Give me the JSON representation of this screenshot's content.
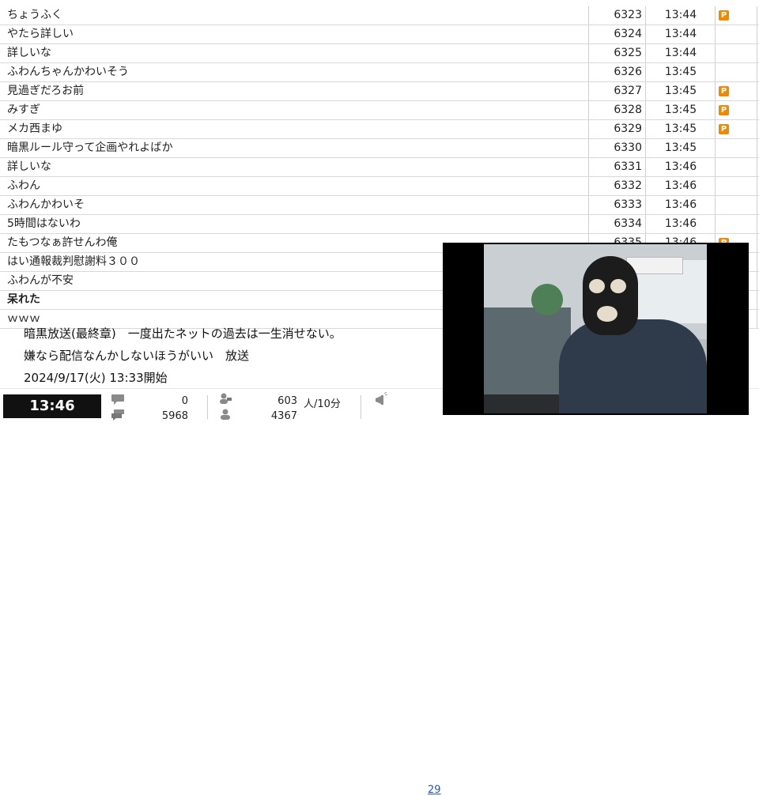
{
  "comments": [
    {
      "text": "ちょうふく",
      "num": "6323",
      "time": "13:44",
      "premium": true,
      "bold": false
    },
    {
      "text": "やたら詳しい",
      "num": "6324",
      "time": "13:44",
      "premium": false,
      "bold": false
    },
    {
      "text": "詳しいな",
      "num": "6325",
      "time": "13:44",
      "premium": false,
      "bold": false
    },
    {
      "text": "ふわんちゃんかわいそう",
      "num": "6326",
      "time": "13:45",
      "premium": false,
      "bold": false
    },
    {
      "text": "見過ぎだろお前",
      "num": "6327",
      "time": "13:45",
      "premium": true,
      "bold": false
    },
    {
      "text": "みすぎ",
      "num": "6328",
      "time": "13:45",
      "premium": true,
      "bold": false
    },
    {
      "text": "メカ西まゆ",
      "num": "6329",
      "time": "13:45",
      "premium": true,
      "bold": false
    },
    {
      "text": "暗黒ルール守って企画やれよばか",
      "num": "6330",
      "time": "13:45",
      "premium": false,
      "bold": false
    },
    {
      "text": "詳しいな",
      "num": "6331",
      "time": "13:46",
      "premium": false,
      "bold": false
    },
    {
      "text": "ふわん",
      "num": "6332",
      "time": "13:46",
      "premium": false,
      "bold": false
    },
    {
      "text": "ふわんかわいそ",
      "num": "6333",
      "time": "13:46",
      "premium": false,
      "bold": false
    },
    {
      "text": "5時間はないわ",
      "num": "6334",
      "time": "13:46",
      "premium": false,
      "bold": false
    },
    {
      "text": "たもつなぁ許せんわ俺",
      "num": "6335",
      "time": "13:46",
      "premium": true,
      "bold": false
    },
    {
      "text": "はい通報裁判慰謝料３００",
      "num": "",
      "time": "",
      "premium": false,
      "bold": false
    },
    {
      "text": "ふわんが不安",
      "num": "",
      "time": "",
      "premium": false,
      "bold": false
    },
    {
      "text": "呆れた",
      "num": "",
      "time": "",
      "premium": false,
      "bold": true
    },
    {
      "text": "ｗｗｗ",
      "num": "",
      "time": "",
      "premium": false,
      "bold": false
    }
  ],
  "premium_label": "P",
  "broadcast": {
    "line1": "暗黒放送(最終章)　一度出たネットの過去は一生消せない。",
    "line2": "嫌なら配信なんかしないほうがいい　放送",
    "line3": "2024/9/17(火) 13:33開始"
  },
  "status": {
    "clock": "13:46",
    "comment_new": "0",
    "comment_total": "5968",
    "viewers_rate": "603",
    "viewers_unit": "人/10分",
    "visitors_total": "4367",
    "link_text": "29"
  },
  "colors": {
    "premium": "#ef8a00",
    "clock_bg": "#111111",
    "link": "#2255cc"
  }
}
